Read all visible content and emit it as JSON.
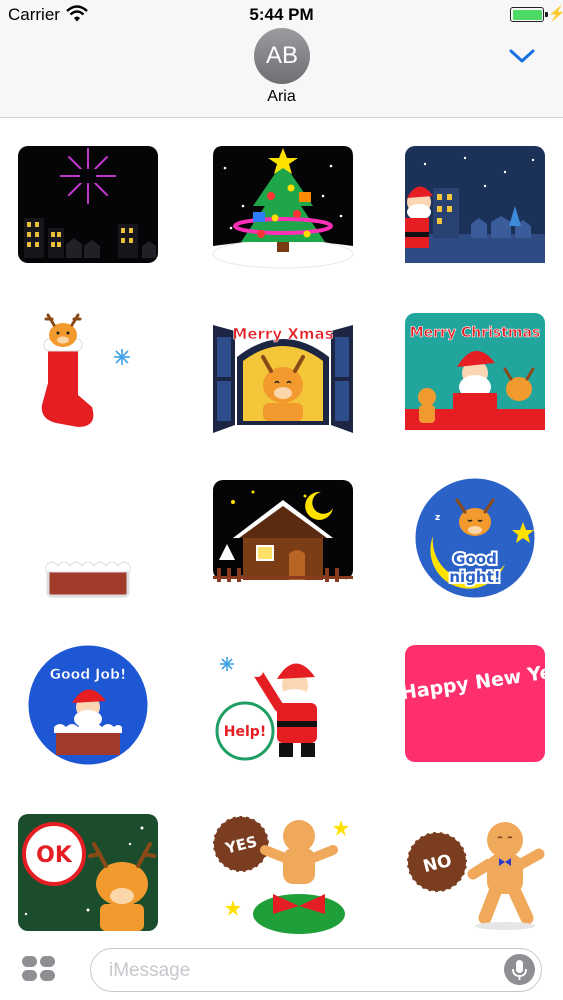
{
  "status_bar": {
    "carrier": "Carrier",
    "time": "5:44 PM",
    "battery_level": 1.0
  },
  "header": {
    "avatar_initials": "AB",
    "contact_name": "Aria"
  },
  "stickers": {
    "merry_xmas": "Merry Xmas",
    "merry_christmas": "Merry Christmas",
    "good_night_1": "Good",
    "good_night_2": "night!",
    "good_job": "Good Job!",
    "help": "Help!",
    "happy_new_year": "Happy New Ye",
    "ok": "OK",
    "yes": "YES",
    "no": "NO"
  },
  "compose": {
    "placeholder": "iMessage"
  },
  "colors": {
    "accent": "#1a6fe0",
    "santa_red": "#e51e24",
    "reindeer": "#f29a2e",
    "pink": "#ff2e6d"
  }
}
